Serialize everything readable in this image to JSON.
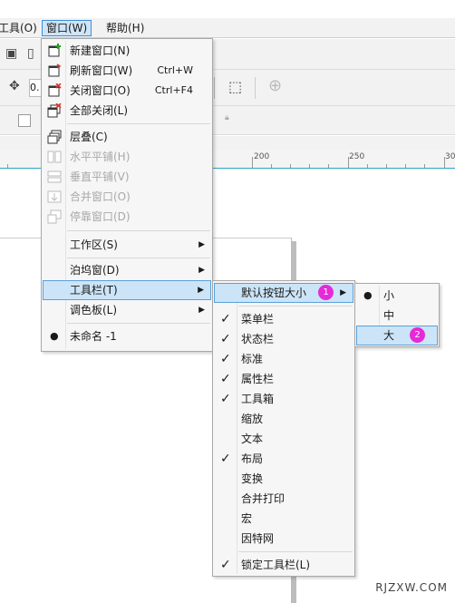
{
  "menubar": {
    "items": [
      {
        "label": "工具(O)"
      },
      {
        "label": "窗口(W)",
        "active": true
      },
      {
        "label": "帮助(H)"
      }
    ]
  },
  "toolbar": {
    "coord_value": "0.",
    "ruler_labels": [
      "200",
      "250",
      "30"
    ]
  },
  "window_menu": {
    "items": [
      {
        "label": "新建窗口(N)",
        "shortcut": "",
        "enabled": true,
        "icon": "new-window-icon"
      },
      {
        "label": "刷新窗口(W)",
        "shortcut": "Ctrl+W",
        "enabled": true,
        "icon": "refresh-window-icon"
      },
      {
        "label": "关闭窗口(O)",
        "shortcut": "Ctrl+F4",
        "enabled": true,
        "icon": "close-window-icon"
      },
      {
        "label": "全部关闭(L)",
        "shortcut": "",
        "enabled": true,
        "icon": "close-all-icon"
      },
      {
        "label": "层叠(C)",
        "enabled": true,
        "icon": "cascade-icon"
      },
      {
        "label": "水平平铺(H)",
        "enabled": false,
        "icon": "tile-horizontal-icon"
      },
      {
        "label": "垂直平铺(V)",
        "enabled": false,
        "icon": "tile-vertical-icon"
      },
      {
        "label": "合并窗口(O)",
        "enabled": false,
        "icon": "merge-windows-icon"
      },
      {
        "label": "停靠窗口(D)",
        "enabled": false,
        "icon": "dock-window-icon"
      },
      {
        "label": "工作区(S)",
        "submenu": true
      },
      {
        "label": "泊坞窗(D)",
        "submenu": true
      },
      {
        "label": "工具栏(T)",
        "submenu": true,
        "highlighted": true
      },
      {
        "label": "调色板(L)",
        "submenu": true
      },
      {
        "label": "未命名 -1",
        "bullet": true
      }
    ]
  },
  "toolbars_menu": {
    "items": [
      {
        "label": "默认按钮大小",
        "submenu": true,
        "highlighted": true,
        "badge": "1"
      },
      {
        "label": "菜单栏",
        "checked": true
      },
      {
        "label": "状态栏",
        "checked": true
      },
      {
        "label": "标准",
        "checked": true
      },
      {
        "label": "属性栏",
        "checked": true
      },
      {
        "label": "工具箱",
        "checked": true
      },
      {
        "label": "缩放",
        "checked": false
      },
      {
        "label": "文本",
        "checked": false
      },
      {
        "label": "布局",
        "checked": true
      },
      {
        "label": "变换",
        "checked": false
      },
      {
        "label": "合并打印",
        "checked": false
      },
      {
        "label": "宏",
        "checked": false
      },
      {
        "label": "因特网",
        "checked": false
      },
      {
        "label": "锁定工具栏(L)",
        "checked": true
      }
    ]
  },
  "size_menu": {
    "items": [
      {
        "label": "小",
        "bullet": true
      },
      {
        "label": "中",
        "bullet": false
      },
      {
        "label": "大",
        "bullet": false,
        "highlighted": true,
        "badge": "2"
      }
    ]
  },
  "watermark": "RJZXW.COM"
}
